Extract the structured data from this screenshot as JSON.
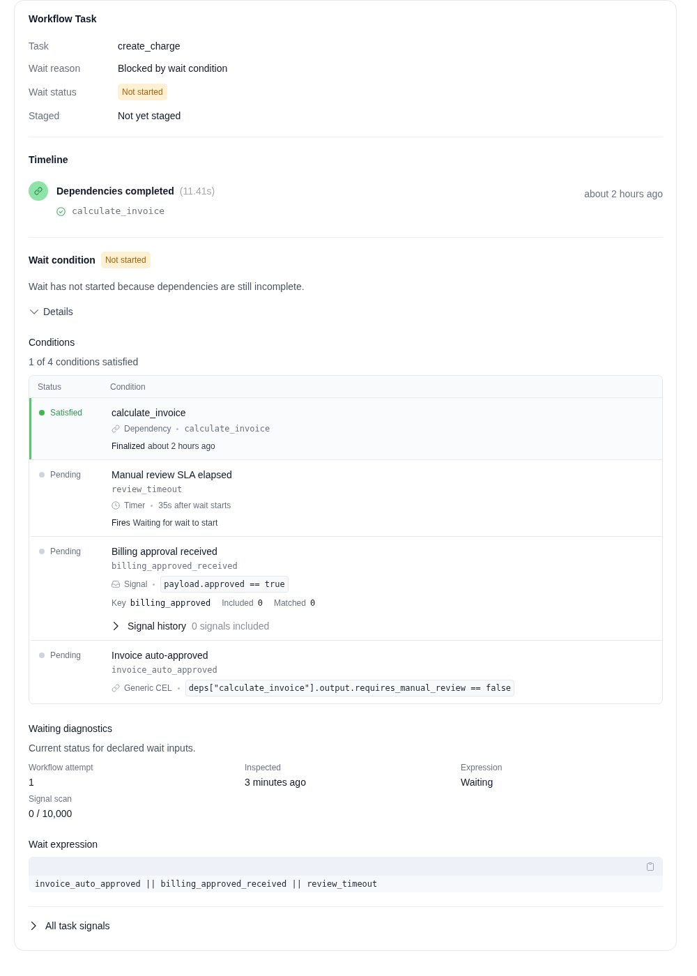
{
  "task": {
    "title": "Workflow Task",
    "fields": [
      {
        "label": "Task",
        "value": "create_charge",
        "kind": "text"
      },
      {
        "label": "Wait reason",
        "value": "Blocked by wait condition",
        "kind": "text"
      },
      {
        "label": "Wait status",
        "value": "Not started",
        "kind": "badge"
      },
      {
        "label": "Staged",
        "value": "Not yet staged",
        "kind": "text"
      }
    ]
  },
  "timeline": {
    "title": "Timeline",
    "events": [
      {
        "kind": "dependency",
        "title": "Dependencies completed",
        "duration": "(11.41s)",
        "time": "about 2 hours ago",
        "items": [
          {
            "name": "calculate_invoice",
            "done": true
          }
        ]
      }
    ]
  },
  "wait_condition": {
    "title": "Wait condition",
    "badge": "Not started",
    "description": "Wait has not started because dependencies are still incomplete.",
    "details": {
      "label": "Details",
      "expanded": true
    }
  },
  "conditions": {
    "title": "Conditions",
    "summary": "1 of 4 conditions satisfied",
    "columns": [
      "Status",
      "Condition"
    ],
    "rows": [
      {
        "status": "Satisfied",
        "satisfied": true,
        "color": "#3fb950",
        "name": "calculate_invoice",
        "type": {
          "kind": "dependency",
          "label": "Dependency"
        },
        "detail": {
          "kind": "mono",
          "text": "calculate_invoice"
        },
        "footer": {
          "label": "Finalized",
          "value": "about 2 hours ago"
        }
      },
      {
        "status": "Pending",
        "satisfied": false,
        "color": "#d1d5db",
        "name": "Manual review SLA elapsed",
        "key": "review_timeout",
        "type": {
          "kind": "timer",
          "label": "Timer"
        },
        "detail": {
          "kind": "text",
          "text": "35s after wait starts"
        },
        "footer": {
          "label": "Fires",
          "value": "Waiting for wait to start"
        }
      },
      {
        "status": "Pending",
        "satisfied": false,
        "color": "#d1d5db",
        "name": "Billing approval received",
        "key": "billing_approved_received",
        "type": {
          "kind": "signal",
          "label": "Signal"
        },
        "detail": {
          "kind": "code",
          "text": "payload.approved == true"
        },
        "meta": [
          {
            "label": "Key",
            "value": "billing_approved"
          },
          {
            "label": "Included",
            "value": "0"
          },
          {
            "label": "Matched",
            "value": "0"
          }
        ],
        "history": {
          "label": "Signal history",
          "summary": "0 signals included",
          "expanded": false
        }
      },
      {
        "status": "Pending",
        "satisfied": false,
        "color": "#d1d5db",
        "name": "Invoice auto-approved",
        "key": "invoice_auto_approved",
        "type": {
          "kind": "cel",
          "label": "Generic CEL"
        },
        "detail": {
          "kind": "code",
          "text": "deps[\"calculate_invoice\"].output.requires_manual_review == false"
        }
      }
    ]
  },
  "diagnostics": {
    "title": "Waiting diagnostics",
    "description": "Current status for declared wait inputs.",
    "stats": [
      {
        "label": "Workflow attempt",
        "value": "1"
      },
      {
        "label": "Inspected",
        "value": "3 minutes ago"
      },
      {
        "label": "Expression",
        "value": "Waiting"
      },
      {
        "label": "Signal scan",
        "value": "0 / 10,000"
      }
    ]
  },
  "wait_expression": {
    "title": "Wait expression",
    "code": "invoice_auto_approved || billing_approved_received || review_timeout"
  },
  "all_task_signals": {
    "label": "All task signals",
    "expanded": false
  }
}
